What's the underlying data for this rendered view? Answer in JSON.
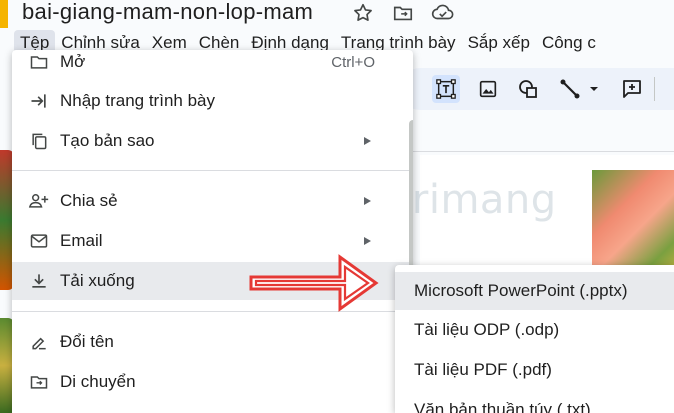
{
  "document": {
    "title": "bai-giang-mam-non-lop-mam",
    "title_icons": [
      "star-icon",
      "move-to-folder-icon",
      "cloud-saved-icon"
    ]
  },
  "menubar": {
    "items": [
      "Tệp",
      "Chỉnh sửa",
      "Xem",
      "Chèn",
      "Định dạng",
      "Trang trình bày",
      "Sắp xếp",
      "Công c"
    ],
    "active": "Tệp"
  },
  "toolbar": {
    "icons": [
      "text-box-icon",
      "image-icon",
      "shapes-icon",
      "line-icon",
      "line-dropdown-icon",
      "comment-add-icon"
    ]
  },
  "file_menu": {
    "items": [
      {
        "icon": "folder-open-icon",
        "label": "Mở",
        "shortcut": "Ctrl+O"
      },
      {
        "icon": "import-icon",
        "label": "Nhập trang trình bày"
      },
      {
        "icon": "copy-icon",
        "label": "Tạo bản sao",
        "submenu": true
      },
      {
        "icon": "share-icon",
        "label": "Chia sẻ",
        "submenu": true
      },
      {
        "icon": "email-icon",
        "label": "Email",
        "submenu": true
      },
      {
        "icon": "download-icon",
        "label": "Tải xuống",
        "submenu": true,
        "highlighted": true
      },
      {
        "icon": "rename-icon",
        "label": "Đổi tên"
      },
      {
        "icon": "move-icon",
        "label": "Di chuyển"
      }
    ]
  },
  "download_submenu": {
    "items": [
      {
        "label": "Microsoft PowerPoint (.pptx)",
        "highlighted": true
      },
      {
        "label": "Tài liệu ODP (.odp)"
      },
      {
        "label": "Tài liệu PDF (.pdf)"
      },
      {
        "label": "Văn bản thuần túy (.txt)"
      }
    ]
  },
  "watermark": {
    "text": "uantrimang"
  },
  "colors": {
    "annotation_arrow": "#e53935",
    "menu_highlight": "#e8eaed",
    "toolbar_bg": "#edf2fa",
    "selected_tool": "#d3e3fd"
  }
}
